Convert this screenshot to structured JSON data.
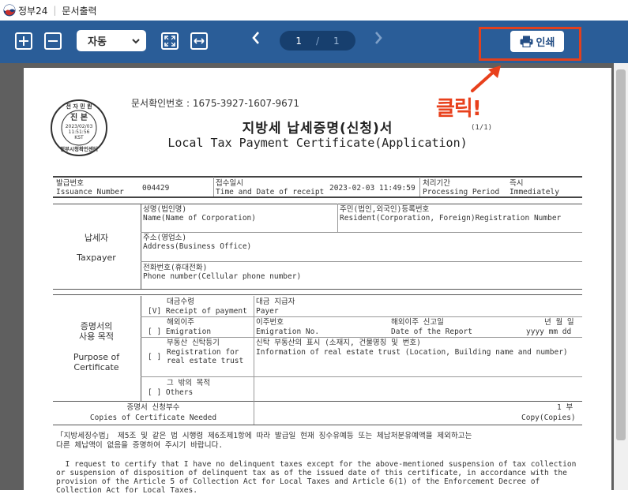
{
  "titlebar": {
    "app": "정부24",
    "section": "문서출력"
  },
  "toolbar": {
    "zoom_value": "자동",
    "page_current": "1",
    "page_separator": "/",
    "page_total": "1",
    "print_label": "인쇄"
  },
  "annotation": {
    "click_label": "클릭!"
  },
  "document": {
    "seal": {
      "top": "전 자 민 원",
      "middle": "진 본",
      "date": "2023/02/03",
      "time": "11:51:56",
      "tz": "KST",
      "bottom": "정부시청확인센터"
    },
    "doc_number": "문서확인번호 : 1675-3927-1607-9671",
    "title_ko": "지방세 납세증명(신청)서",
    "page_count": "(1/1)",
    "title_en": "Local Tax Payment Certificate(Application)",
    "header_row": {
      "issue_no_ko": "발급번호",
      "issue_no_en": "Issuance Number",
      "issue_no_value": "004429",
      "receipt_ko": "접수일시",
      "receipt_en": "Time and Date of receipt",
      "receipt_value": "2023-02-03 11:49:59",
      "processing_ko": "처리기간",
      "processing_en": "Processing Period",
      "processing_value_ko": "즉시",
      "processing_value_en": "Immediately"
    },
    "taxpayer": {
      "label_ko": "납세자",
      "label_en": "Taxpayer",
      "name_ko": "성명(법인명)",
      "name_en": "Name(Name of Corporation)",
      "regno_ko": "주민(법인,외국인)등록번호",
      "regno_en": "Resident(Corporation, Foreign)Registration Number",
      "addr_ko": "주소(영업소)",
      "addr_en": "Address(Business Office)",
      "phone_ko": "전화번호(휴대전화)",
      "phone_en": "Phone number(Cellular phone number)"
    },
    "purpose": {
      "label_ko1": "증명서의",
      "label_ko2": "사용 목적",
      "label_en1": "Purpose of",
      "label_en2": "Certificate",
      "r1_ko": "대금수령",
      "r1_check": "[V] Receipt of payment",
      "r1_right_ko": "대금 지급자",
      "r1_right_en": "Payer",
      "r2_ko": "해외이주",
      "r2_check": "[ ]  Emigration",
      "r2_no_ko": "이주번호",
      "r2_no_en": "Emigration No.",
      "r2_date_ko": "해외이주 신고일",
      "r2_date_en": "Date of the Report",
      "r2_ymd_ko": "년 월 일",
      "r2_ymd_en": "yyyy  mm  dd",
      "r3_ko": "부동산 신탁등기",
      "r3_en1": "Registration for",
      "r3_en2": "real estate trust",
      "r3_check": "[ ]",
      "r3_right_ko": "신탁 부동산의 표시 (소재지, 건물명칭 및 번호)",
      "r3_right_en": "Information of real estate trust (Location, Building name and number)",
      "r4_ko": "그 밖의 목적",
      "r4_check": "[ ] Others"
    },
    "copies": {
      "label_ko": "증명서 신청부수",
      "label_en": "Copies of Certificate Needed",
      "value_ko": "1 부",
      "value_en": "Copy(Copies)"
    },
    "para_ko_1": "「지방세징수법」 제5조 및 같은 법 시행령 제6조제1항에 따라 발급일 현재 징수유예등 또는 체납처분유예액을 제외하고는",
    "para_ko_2": "다른 체납액이 없음을 증명하여 주시기 바랍니다.",
    "para_en_1": "  I request to certify that I have no delinquent taxes except for the above-mentioned suspension of tax collection",
    "para_en_2": "or suspension of disposition of delinquent tax as of the issued date of this certificate, in accordance with the",
    "para_en_3": "provision of the Article 5 of Collection Act for Local Taxes and Article 6(1) of the Enforcement Decree of",
    "para_en_4": "Collection Act for Local Taxes."
  },
  "colors": {
    "toolbar": "#2a5d98",
    "highlight": "#e3401d",
    "viewer_bg": "#5f5f5f"
  }
}
